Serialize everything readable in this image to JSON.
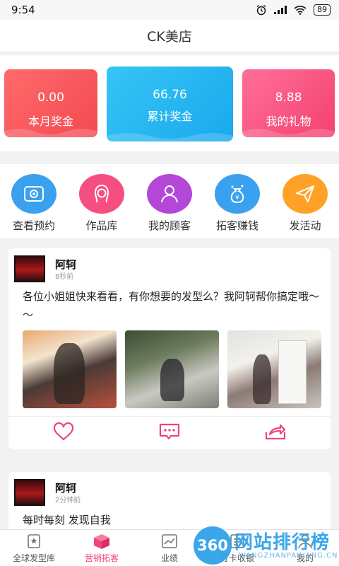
{
  "status": {
    "time": "9:54",
    "battery": "89"
  },
  "header": {
    "title": "CK美店"
  },
  "stats": [
    {
      "value": "0.00",
      "label": "本月奖金",
      "color": "#f24a52"
    },
    {
      "value": "66.76",
      "label": "累计奖金",
      "color": "#1aa9ee"
    },
    {
      "value": "8.88",
      "label": "我的礼物",
      "color": "#f4416f"
    }
  ],
  "menu": [
    {
      "label": "查看预约",
      "icon": "appointment-icon",
      "color": "#3aa1ee"
    },
    {
      "label": "作品库",
      "icon": "hairstyle-icon",
      "color": "#f44f80"
    },
    {
      "label": "我的顾客",
      "icon": "customers-icon",
      "color": "#b247d8"
    },
    {
      "label": "拓客赚钱",
      "icon": "money-bag-icon",
      "color": "#3aa1ee"
    },
    {
      "label": "发活动",
      "icon": "paper-plane-icon",
      "color": "#ffa126"
    }
  ],
  "posts": [
    {
      "author": "阿轲",
      "time": "8秒前",
      "text": "各位小姐姐快来看看，有你想要的发型么？我阿轲帮你搞定哦～～"
    },
    {
      "author": "阿轲",
      "time": "2分钟前",
      "text": "每时每刻 发现自我"
    }
  ],
  "tabs": [
    {
      "label": "全球发型库",
      "icon": "star-book-icon"
    },
    {
      "label": "营销拓客",
      "icon": "gift-box-icon",
      "active": true
    },
    {
      "label": "业绩",
      "icon": "chart-icon"
    },
    {
      "label": "打卡收银",
      "icon": "cashier-icon"
    },
    {
      "label": "我的",
      "icon": "profile-icon"
    }
  ],
  "watermark": {
    "logo": "360",
    "text": "网站排行榜",
    "url": "WANGZHANPAIHANG.CN"
  },
  "accent": "#f0437a"
}
